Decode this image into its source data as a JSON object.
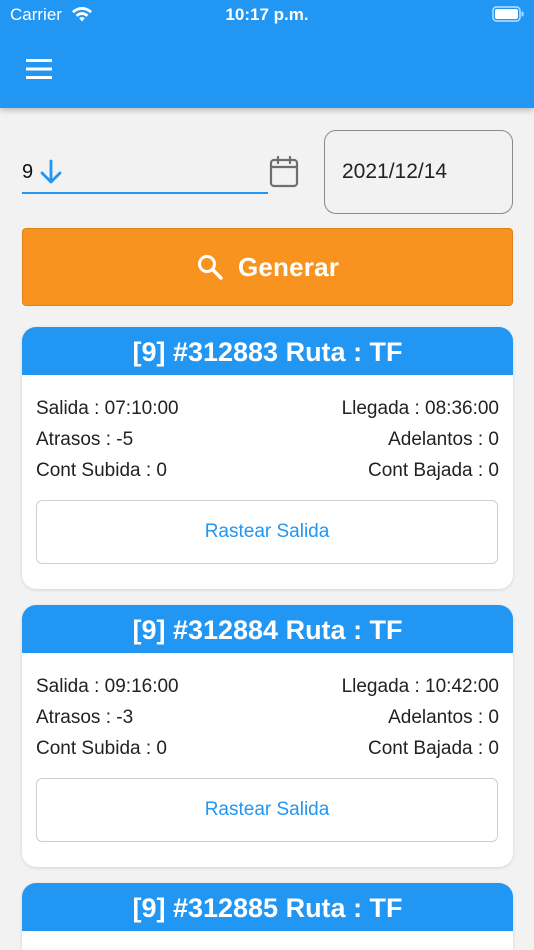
{
  "status_bar": {
    "carrier": "Carrier",
    "time": "10:17 p.m."
  },
  "app_bar": {
    "menu_icon": "hamburger-menu-icon"
  },
  "filters": {
    "route_value": "9",
    "route_icon": "arrow-down-icon",
    "calendar_icon": "calendar-icon",
    "date_value": "2021/12/14"
  },
  "generate_button": {
    "label": "Generar",
    "icon": "search-icon",
    "color": "#f7931e"
  },
  "colors": {
    "primary": "#2196f3",
    "accent": "#f7931e"
  },
  "cards": [
    {
      "title": "[9] #312883 Ruta : TF",
      "salida": "Salida : 07:10:00",
      "llegada": "Llegada : 08:36:00",
      "atrasos": "Atrasos : -5",
      "adelantos": "Adelantos : 0",
      "cont_subida": "Cont Subida : 0",
      "cont_bajada": "Cont Bajada : 0",
      "track_label": "Rastear Salida"
    },
    {
      "title": "[9] #312884 Ruta : TF",
      "salida": "Salida : 09:16:00",
      "llegada": "Llegada : 10:42:00",
      "atrasos": "Atrasos : -3",
      "adelantos": "Adelantos : 0",
      "cont_subida": "Cont Subida : 0",
      "cont_bajada": "Cont Bajada : 0",
      "track_label": "Rastear Salida"
    },
    {
      "title": "[9] #312885 Ruta : TF"
    }
  ]
}
